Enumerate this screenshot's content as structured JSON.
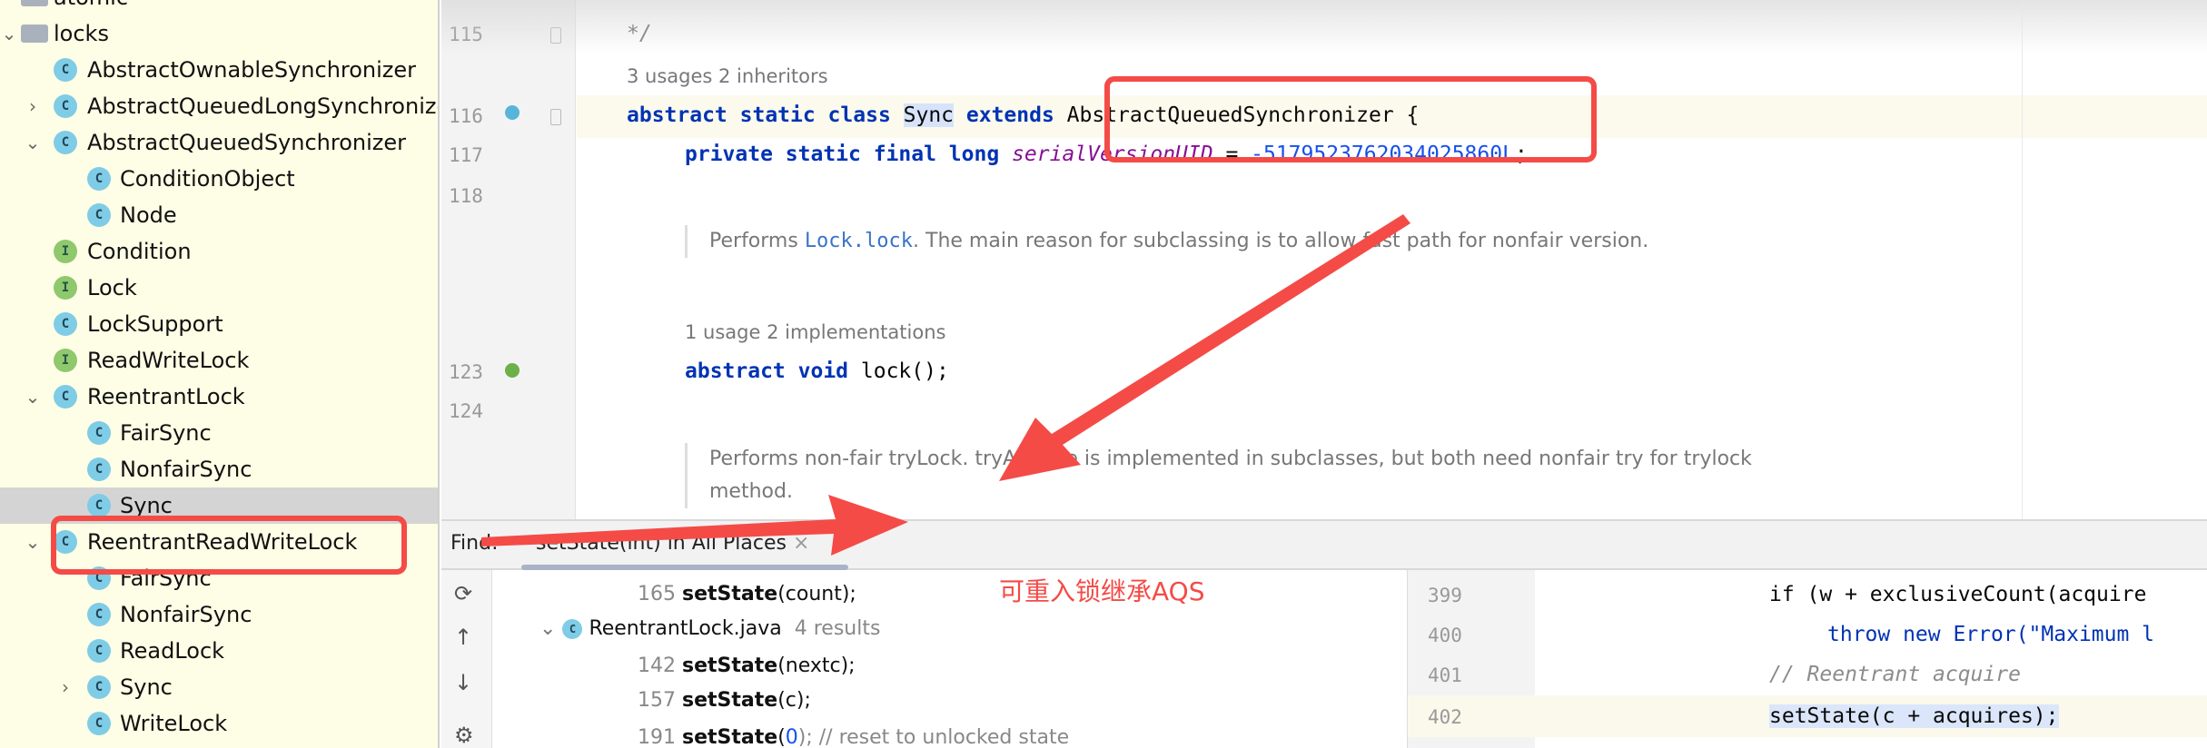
{
  "project_tree": {
    "items": [
      {
        "label": "atomic",
        "type": "folder",
        "level": 1,
        "chevron": ""
      },
      {
        "label": "locks",
        "type": "folder",
        "level": 1,
        "chevron": "down"
      },
      {
        "label": "AbstractOwnableSynchronizer",
        "type": "abstract-class",
        "level": 2,
        "chevron": ""
      },
      {
        "label": "AbstractQueuedLongSynchronizer",
        "type": "abstract-class",
        "level": 2,
        "chevron": "right"
      },
      {
        "label": "AbstractQueuedSynchronizer",
        "type": "abstract-class",
        "level": 2,
        "chevron": "down"
      },
      {
        "label": "ConditionObject",
        "type": "class",
        "level": 3,
        "chevron": ""
      },
      {
        "label": "Node",
        "type": "class",
        "level": 3,
        "chevron": ""
      },
      {
        "label": "Condition",
        "type": "interface",
        "level": 2,
        "chevron": ""
      },
      {
        "label": "Lock",
        "type": "interface",
        "level": 2,
        "chevron": ""
      },
      {
        "label": "LockSupport",
        "type": "class",
        "level": 2,
        "chevron": ""
      },
      {
        "label": "ReadWriteLock",
        "type": "interface",
        "level": 2,
        "chevron": ""
      },
      {
        "label": "ReentrantLock",
        "type": "class",
        "level": 2,
        "chevron": "down"
      },
      {
        "label": "FairSync",
        "type": "class",
        "level": 3,
        "chevron": ""
      },
      {
        "label": "NonfairSync",
        "type": "class",
        "level": 3,
        "chevron": ""
      },
      {
        "label": "Sync",
        "type": "abstract-class",
        "level": 3,
        "chevron": "",
        "selected": true
      },
      {
        "label": "ReentrantReadWriteLock",
        "type": "class",
        "level": 2,
        "chevron": "down"
      },
      {
        "label": "FairSync",
        "type": "class",
        "level": 3,
        "chevron": ""
      },
      {
        "label": "NonfairSync",
        "type": "class",
        "level": 3,
        "chevron": ""
      },
      {
        "label": "ReadLock",
        "type": "class",
        "level": 3,
        "chevron": ""
      },
      {
        "label": "Sync",
        "type": "abstract-class",
        "level": 3,
        "chevron": "right"
      },
      {
        "label": "WriteLock",
        "type": "class",
        "level": 3,
        "chevron": ""
      }
    ]
  },
  "editor": {
    "line_numbers": {
      "l115": "115",
      "l116": "116",
      "l117": "117",
      "l118": "118",
      "l123": "123",
      "l124": "124"
    },
    "comment_end": "*/",
    "hint_116": "3 usages   2 inheritors",
    "line_116": {
      "kw": "abstract static class ",
      "name": "Sync",
      "kw2": " extends ",
      "rest": "AbstractQueuedSynchronizer {"
    },
    "line_117": {
      "kw": "private static final long ",
      "field": "serialVersionUID",
      "eq": " = ",
      "value": "-5179523762034025860L",
      "end": ";"
    },
    "doc_1": {
      "pre": "Performs ",
      "link": "Lock.lock",
      "post": ". The main reason for subclassing is to allow fast path for nonfair version."
    },
    "hint_123": "1 usage   2 implementations",
    "line_123": {
      "kw": "abstract void ",
      "rest": "lock();"
    },
    "doc_2": "Performs non-fair tryLock. tryAcquire is implemented in subclasses, but both need nonfair try for trylock method."
  },
  "find_bar": {
    "label": "Find:",
    "tab": "setState(int) in All Places",
    "close": "×"
  },
  "find_results": {
    "r1": {
      "line": "165",
      "call": "setState",
      "args": "(count);"
    },
    "file": {
      "name": "ReentrantLock.java",
      "count": "4 results"
    },
    "r2": {
      "line": "142",
      "call": "setState",
      "args": "(nextc);"
    },
    "r3": {
      "line": "157",
      "call": "setState",
      "args": "(c);"
    },
    "r4": {
      "line": "191",
      "call": "setState",
      "open": "(",
      "num": "0",
      "args": "); // reset to unlocked state"
    }
  },
  "preview": {
    "lines": [
      {
        "n": "399",
        "text": "if (w + exclusiveCount(acquire"
      },
      {
        "n": "400",
        "text": "throw new Error(\"Maximum l"
      },
      {
        "n": "401",
        "text": "// Reentrant acquire"
      },
      {
        "n": "402",
        "text": "setState(c + acquires);"
      }
    ]
  },
  "annotation": {
    "text": "可重入锁继承AQS",
    "color": "#f44b47"
  }
}
